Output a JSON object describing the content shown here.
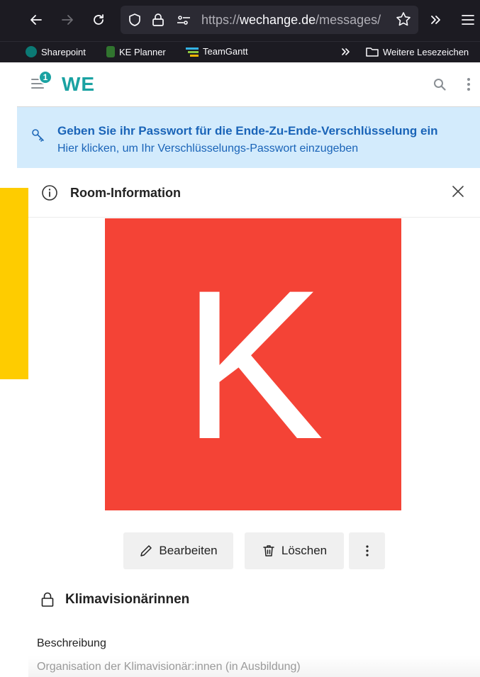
{
  "browser": {
    "url_prefix": "https://",
    "url_domain": "wechange.de",
    "url_path": "/messages/",
    "bookmarks": [
      {
        "label": "Sharepoint",
        "icon": "sharepoint-icon",
        "color": "#0b7a75"
      },
      {
        "label": "KE Planner",
        "icon": "planner-icon",
        "color": "#31752f"
      },
      {
        "label": "TeamGantt",
        "icon": "teamgantt-icon",
        "color": "#34b3e4"
      }
    ],
    "other_bookmarks": "Weitere Lesezeichen"
  },
  "app": {
    "logo": "WE",
    "notification_count": "1",
    "brand_color": "#1aa2a2"
  },
  "encryption_banner": {
    "title": "Geben Sie ihr Passwort für die Ende-Zu-Ende-Verschlüsselung ein",
    "subtitle": "Hier klicken, um Ihr Verschlüsselungs-Passwort einzugeben",
    "background": "#d3ebfc"
  },
  "room_panel": {
    "title": "Room-Information",
    "avatar_letter": "K",
    "avatar_color": "#f44336",
    "actions": {
      "edit_label": "Bearbeiten",
      "delete_label": "Löschen"
    },
    "room_name": "Klimavisionärinnen",
    "description_label": "Beschreibung",
    "description": "Organisation der Klimavisionär:innen (in Ausbildung)"
  }
}
